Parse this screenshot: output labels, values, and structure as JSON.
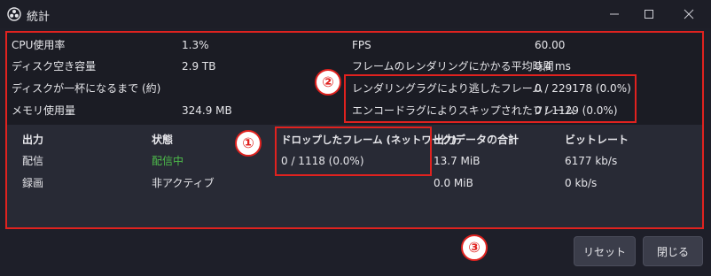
{
  "window": {
    "title": "統計"
  },
  "stats": {
    "cpu_label": "CPU使用率",
    "cpu_value": "1.3%",
    "disk_label": "ディスク空き容量",
    "disk_value": "2.9 TB",
    "disk_full_label": "ディスクが一杯になるまで (約)",
    "mem_label": "メモリ使用量",
    "mem_value": "324.9 MB",
    "fps_label": "FPS",
    "fps_value": "60.00",
    "render_time_label": "フレームのレンダリングにかかる平均時間",
    "render_time_value": "0.4 ms",
    "render_lag_label": "レンダリングラグにより逃したフレーム",
    "render_lag_value": "0 / 229178 (0.0%)",
    "encode_lag_label": "エンコードラグによりスキップされたフレーム",
    "encode_lag_value": "0 / 1129 (0.0%)"
  },
  "output_table": {
    "headers": [
      "出力",
      "状態",
      "ドロップしたフレーム (ネットワーク)",
      "出力データの合計",
      "ビットレート"
    ],
    "rows": [
      [
        "配信",
        "配信中",
        "0 / 1118 (0.0%)",
        "13.7 MiB",
        "6177 kb/s"
      ],
      [
        "録画",
        "非アクティブ",
        "",
        "0.0 MiB",
        "0 kb/s"
      ]
    ]
  },
  "markers": [
    "①",
    "②",
    "③"
  ],
  "buttons": {
    "reset": "リセット",
    "close": "閉じる"
  },
  "colors": {
    "annotation_red": "#e0221f",
    "status_active": "#4ebd4b",
    "background": "#1e1f29"
  }
}
